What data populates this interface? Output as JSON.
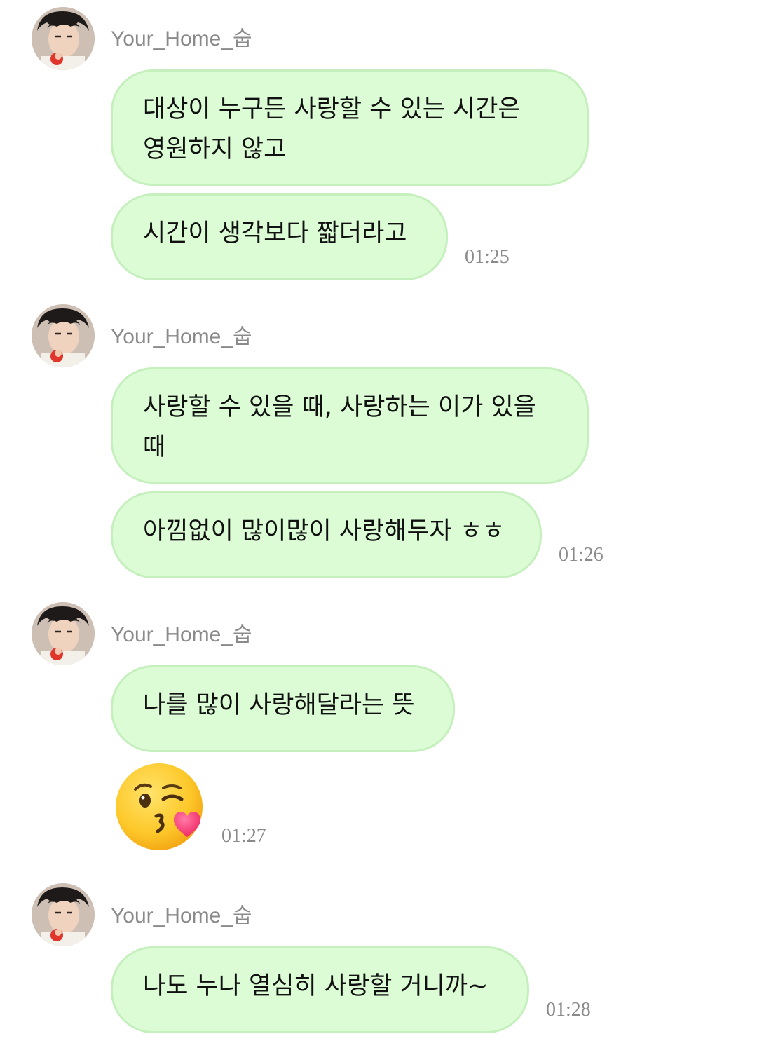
{
  "messages": [
    {
      "sender": "Your_Home_숩",
      "bubbles": [
        "대상이 누구든 사랑할 수 있는 시간은 영원하지 않고",
        "시간이 생각보다 짧더라고"
      ],
      "time": "01:25"
    },
    {
      "sender": "Your_Home_숩",
      "bubbles": [
        "사랑할 수 있을 때, 사랑하는 이가 있을 때",
        "아낌없이 많이많이 사랑해두자 ㅎㅎ"
      ],
      "time": "01:26"
    },
    {
      "sender": "Your_Home_숩",
      "bubbles": [
        "나를 많이 사랑해달라는 뜻"
      ],
      "emoji": "face-blowing-a-kiss-icon",
      "time": "01:27"
    },
    {
      "sender": "Your_Home_숩",
      "bubbles": [
        "나도 누나 열심히 사랑할 거니까~"
      ],
      "time": "01:28"
    }
  ],
  "colors": {
    "bubble_background": "#dcfcd6",
    "bubble_border": "#c5f0bd",
    "sender_text": "#8a8a8a",
    "timestamp_text": "#8a8a8a"
  }
}
